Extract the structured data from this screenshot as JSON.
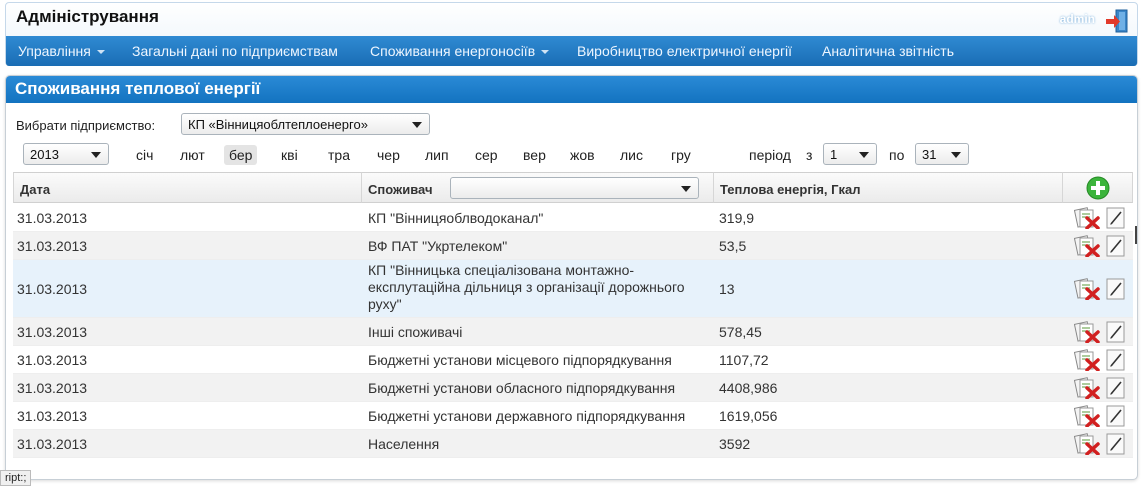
{
  "header": {
    "title": "Адміністрування",
    "user": "admin",
    "nav": [
      {
        "label": "Управління",
        "dropdown": true
      },
      {
        "label": "Загальні дані по підприємствам",
        "dropdown": false
      },
      {
        "label": "Споживання енергоносіїв",
        "dropdown": true
      },
      {
        "label": "Виробництво електричної енергії",
        "dropdown": false
      },
      {
        "label": "Аналітична звітність",
        "dropdown": false
      }
    ]
  },
  "panel": {
    "title": "Споживання теплової енергії",
    "enterprise_label": "Вибрати підприємство:",
    "enterprise_value": "КП «Вінницяоблтеплоенерго»",
    "year": "2013",
    "months": [
      "січ",
      "лют",
      "бер",
      "кві",
      "тра",
      "чер",
      "лип",
      "сер",
      "вер",
      "жов",
      "лис",
      "гру"
    ],
    "active_month": "бер",
    "period_label": "період",
    "from_label": "з",
    "from_value": "1",
    "to_label": "по",
    "to_value": "31"
  },
  "table": {
    "columns": {
      "date": "Дата",
      "consumer": "Споживач",
      "energy": "Теплова енергія, Гкал"
    },
    "consumer_filter": "",
    "rows": [
      {
        "date": "31.03.2013",
        "consumer": "КП \"Вінницяоблводоканал\"",
        "energy": "319,9"
      },
      {
        "date": "31.03.2013",
        "consumer": "ВФ ПАТ \"Укртелеком\"",
        "energy": "53,5"
      },
      {
        "date": "31.03.2013",
        "consumer": "КП \"Вінницька спеціалізована монтажно-експлутаційна дільниця з організації дорожнього руху\"",
        "energy": "13"
      },
      {
        "date": "31.03.2013",
        "consumer": "Інші споживачі",
        "energy": "578,45"
      },
      {
        "date": "31.03.2013",
        "consumer": "Бюджетні установи місцевого підпорядкування",
        "energy": "1107,72"
      },
      {
        "date": "31.03.2013",
        "consumer": "Бюджетні установи обласного підпорядкування",
        "energy": "4408,986"
      },
      {
        "date": "31.03.2013",
        "consumer": "Бюджетні установи державного підпорядкування",
        "energy": "1619,056"
      },
      {
        "date": "31.03.2013",
        "consumer": "Населення",
        "energy": "3592"
      }
    ]
  },
  "status_bar": "ript:;",
  "icons": {
    "exit": "exit-door-icon",
    "add": "add-plus-icon",
    "delete": "delete-doc-icon",
    "edit": "edit-pencil-icon"
  },
  "colors": {
    "nav": "#1a6db4",
    "panel_header": "#1373c0",
    "add": "#3cb43c",
    "delete": "#d12020"
  }
}
